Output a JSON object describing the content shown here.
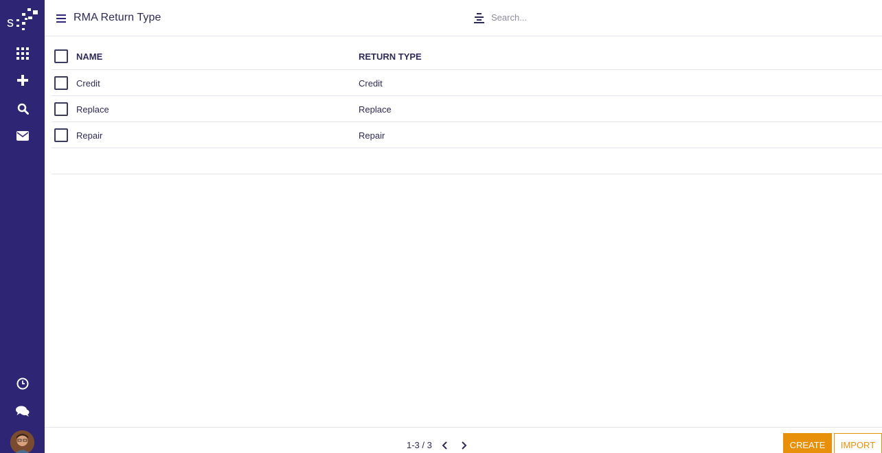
{
  "app": {
    "page_title": "RMA Return Type"
  },
  "sidebar": {
    "items": [
      {
        "icon": "apps-grid-icon"
      },
      {
        "icon": "plus-icon"
      },
      {
        "icon": "search-icon"
      },
      {
        "icon": "mail-icon"
      },
      {
        "icon": "clock-icon"
      },
      {
        "icon": "chat-icon"
      }
    ]
  },
  "search": {
    "placeholder": "Search...",
    "value": ""
  },
  "table": {
    "columns": [
      "NAME",
      "RETURN TYPE"
    ],
    "rows": [
      {
        "name": "Credit",
        "return_type": "Credit"
      },
      {
        "name": "Replace",
        "return_type": "Replace"
      },
      {
        "name": "Repair",
        "return_type": "Repair"
      }
    ]
  },
  "pagination": {
    "label": "1-3 / 3"
  },
  "actions": {
    "create_label": "CREATE",
    "import_label": "IMPORT"
  },
  "colors": {
    "sidebar": "#2e2574",
    "accent": "#e8900a",
    "text": "#2d2a55"
  }
}
